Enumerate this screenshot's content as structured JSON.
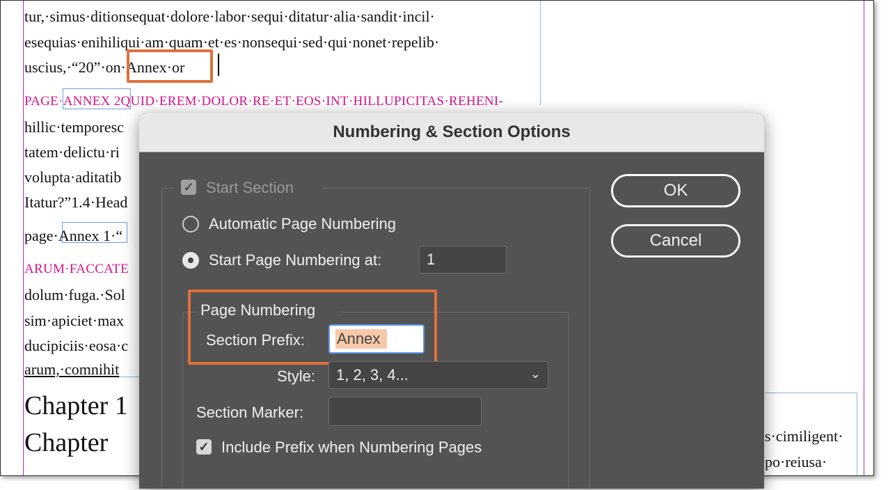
{
  "document": {
    "lines": [
      {
        "text": "tur,·simus·ditionsequat·dolore·labor·sequi·ditatur·alia·sandit·incil·"
      },
      {
        "text": "esequias·enihiliqui·am·quam·et·es·nonsequi·sed·qui·nonet·repelib·"
      },
      {
        "text": "uscius,·“20”·on·Annex·or"
      },
      {
        "text": "PAGE·ANNEX 2QUID·EREM·DOLOR·RE·ET·EOS·INT·HILLUPICITAS·REHENI-"
      },
      {
        "text": "hillic·temporesc"
      },
      {
        "text": "tatem·delictu·ri"
      },
      {
        "text": "volupta·aditatib"
      },
      {
        "text": "Itatur?”1.4·Head"
      },
      {
        "text": "page·Annex 1·“"
      },
      {
        "text": "ARUM·FACCATE"
      },
      {
        "text": "dolum·fuga.·Sol"
      },
      {
        "text": "sim·apiciet·max"
      },
      {
        "text": "ducipiciis·eosa·c"
      },
      {
        "text": "arum,·comnihit"
      },
      {
        "text": "Chapter 1"
      },
      {
        "text": "Chapter"
      }
    ],
    "right_lines": [
      {
        "text": "s·cimiligent·"
      },
      {
        "text": "po·reiusa·"
      }
    ]
  },
  "dialog": {
    "title": "Numbering & Section Options",
    "start_section": {
      "label": "Start Section",
      "checked": true,
      "disabled": true
    },
    "auto_numbering": {
      "label": "Automatic Page Numbering",
      "selected": false
    },
    "start_at": {
      "label": "Start Page Numbering at:",
      "selected": true,
      "value": "1"
    },
    "page_numbering": {
      "group_label": "Page Numbering",
      "section_prefix": {
        "label": "Section Prefix:",
        "value": "Annex"
      },
      "style": {
        "label": "Style:",
        "value": "1, 2, 3, 4..."
      },
      "section_marker": {
        "label": "Section Marker:",
        "value": ""
      },
      "include_prefix": {
        "label": "Include Prefix when Numbering Pages",
        "checked": true
      }
    },
    "buttons": {
      "ok": "OK",
      "cancel": "Cancel"
    }
  },
  "colors": {
    "dialog_bg": "#535353",
    "highlight": "#e0703a",
    "section_heading": "#d4148c",
    "selection": "#f7c9a8"
  }
}
